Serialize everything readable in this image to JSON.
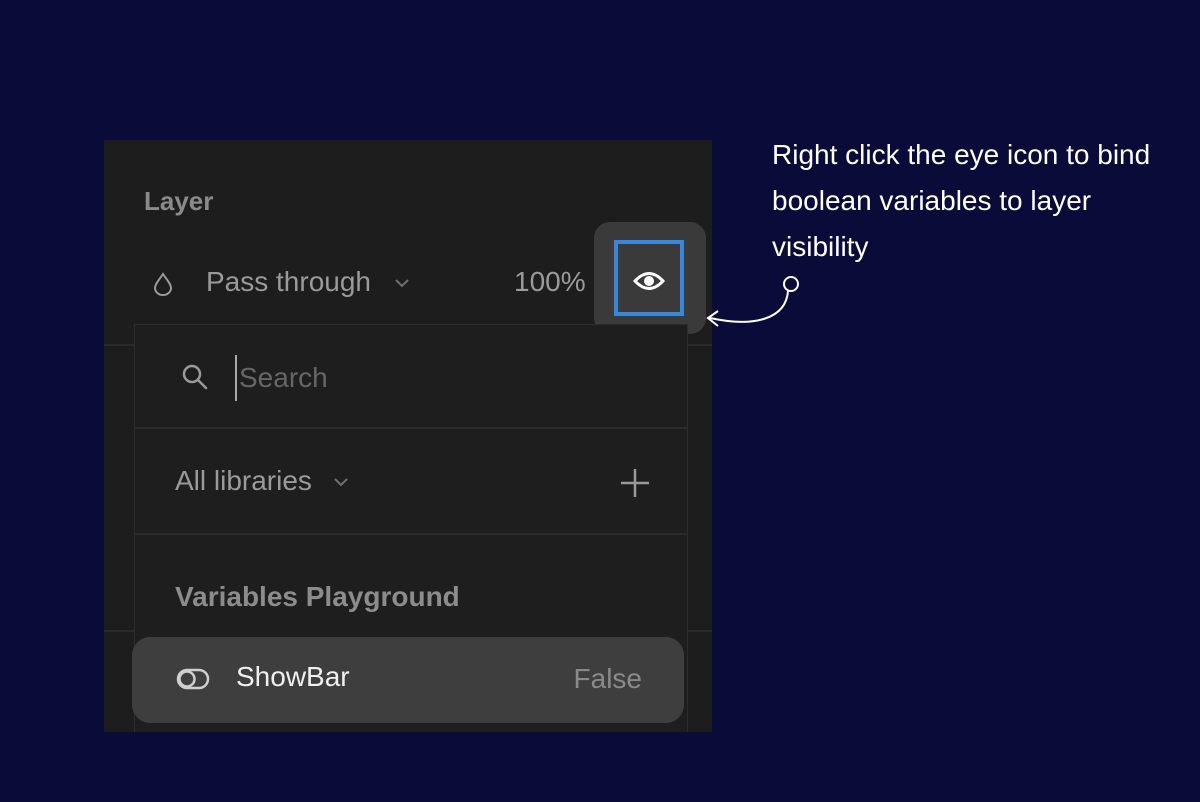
{
  "layer_panel": {
    "title": "Layer",
    "blend_mode": "Pass through",
    "opacity": "100%"
  },
  "variable_picker": {
    "search_placeholder": "Search",
    "library_filter": "All libraries",
    "group_name": "Variables Playground",
    "variables": [
      {
        "name": "ShowBar",
        "value": "False",
        "icon": "boolean-toggle-icon"
      }
    ]
  },
  "annotation": {
    "text": "Right click the eye icon to bind boolean variables to layer visibility"
  },
  "colors": {
    "background": "#0a0b38",
    "panel": "#1d1d1d",
    "highlight": "#3b86d6"
  }
}
